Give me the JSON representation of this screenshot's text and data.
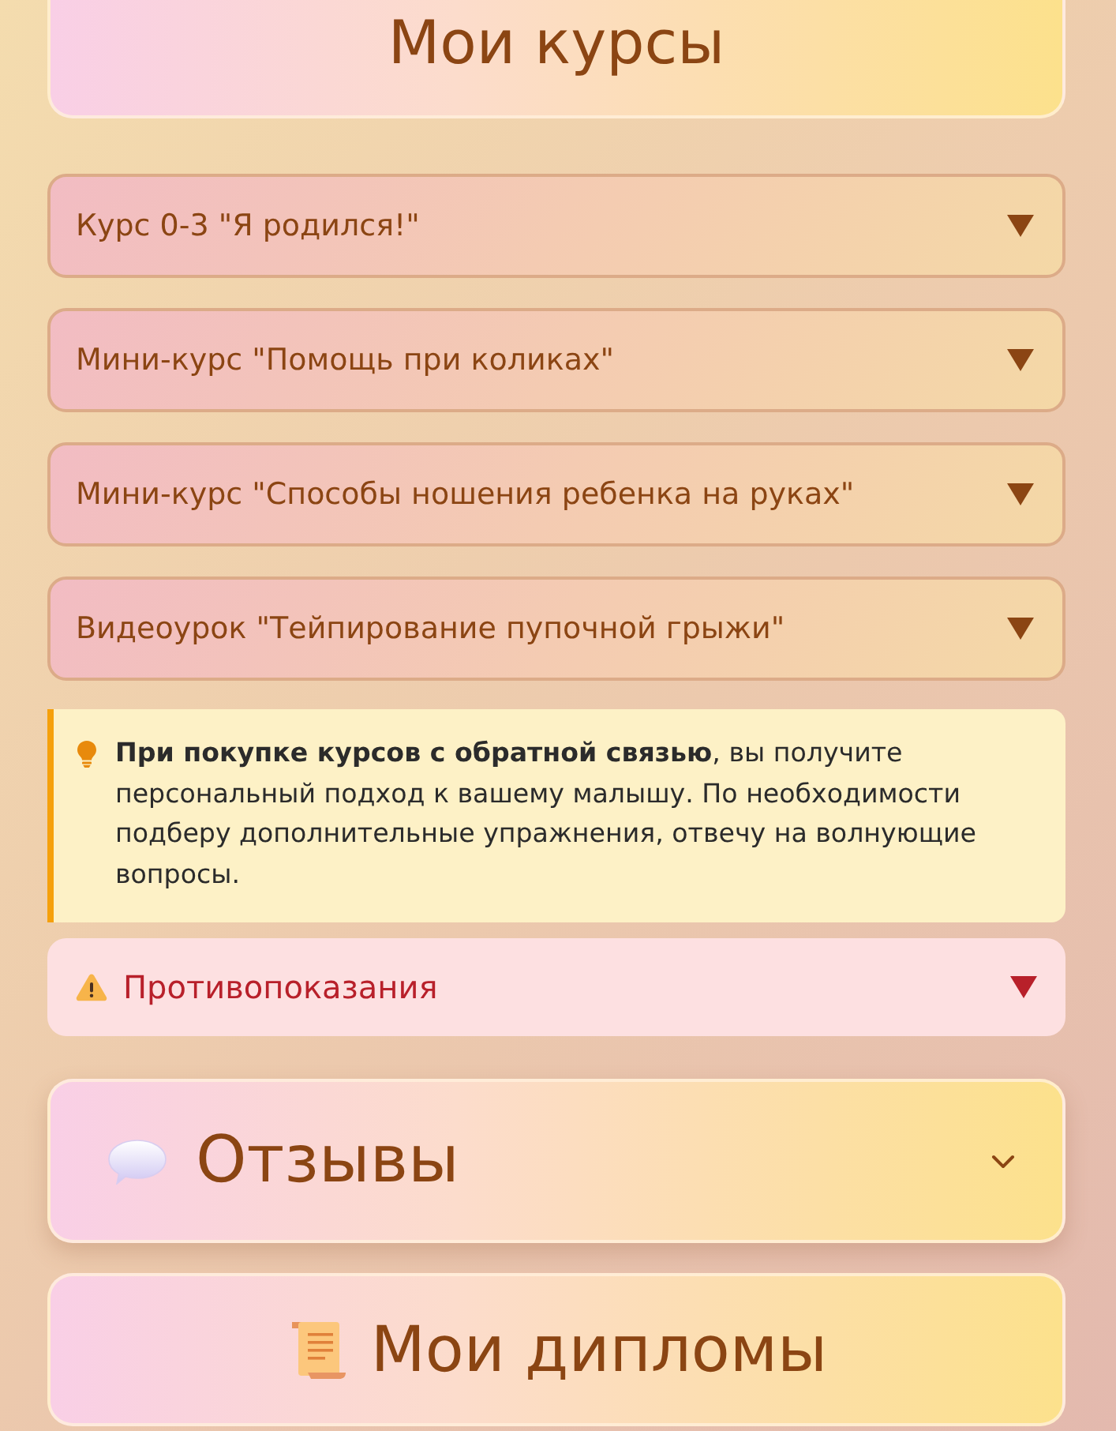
{
  "header": {
    "title": "Мои курсы"
  },
  "courses": [
    {
      "title": "Курс 0-3 \"Я родился!\"",
      "expanded": false
    },
    {
      "title": "Мини-курс \"Помощь при коликах\"",
      "expanded": false
    },
    {
      "title": "Мини-курс \"Способы ношения ребенка на руках\"",
      "expanded": false
    },
    {
      "title": "Видеоурок \"Тейпирование пупочной грыжи\"",
      "expanded": false
    }
  ],
  "note": {
    "text": "**При покупке курсов с обратной связью**, вы получите персональный подход к вашему малышу. По необходимости подберу дополнительные упражнения, отвечу на волнующие вопросы."
  },
  "warning": {
    "title": "Противопоказания",
    "expanded": false
  },
  "reviews": {
    "title": "Отзывы",
    "expanded": false
  },
  "diplomas": {
    "title": "Мои дипломы"
  }
}
